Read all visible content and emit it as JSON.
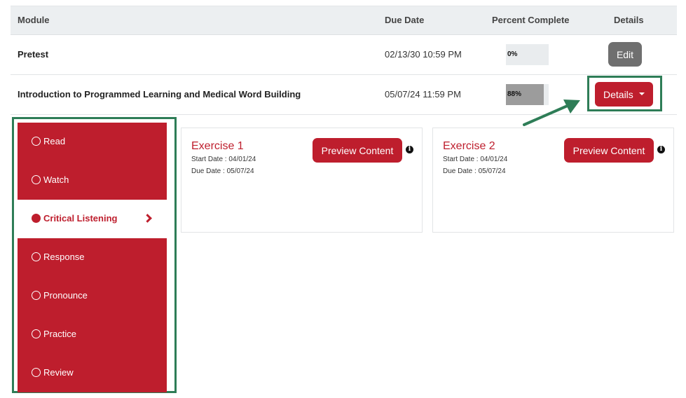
{
  "table": {
    "headers": {
      "module": "Module",
      "due_date": "Due Date",
      "percent": "Percent Complete",
      "details": "Details"
    },
    "rows": [
      {
        "name": "Pretest",
        "due": "02/13/30 10:59 PM",
        "percent_text": "0%",
        "percent": 0,
        "action": "Edit"
      },
      {
        "name": "Introduction to Programmed Learning and Medical Word Building",
        "due": "05/07/24 11:59 PM",
        "percent_text": "88%",
        "percent": 88,
        "action": "Details"
      }
    ]
  },
  "sidebar": {
    "items": [
      {
        "label": "Read",
        "active": false
      },
      {
        "label": "Watch",
        "active": false
      },
      {
        "label": "Critical Listening",
        "active": true
      },
      {
        "label": "Response",
        "active": false
      },
      {
        "label": "Pronounce",
        "active": false
      },
      {
        "label": "Practice",
        "active": false
      },
      {
        "label": "Review",
        "active": false
      }
    ]
  },
  "exercises": [
    {
      "title": "Exercise 1",
      "start": "Start Date : 04/01/24",
      "due": "Due Date : 05/07/24",
      "button": "Preview Content",
      "info_icon": "i"
    },
    {
      "title": "Exercise 2",
      "start": "Start Date : 04/01/24",
      "due": "Due Date : 05/07/24",
      "button": "Preview Content",
      "info_icon": "i"
    }
  ],
  "colors": {
    "brand_red": "#be1e2d",
    "highlight_green": "#2e7d57",
    "edit_gray": "#6f6f6f"
  }
}
